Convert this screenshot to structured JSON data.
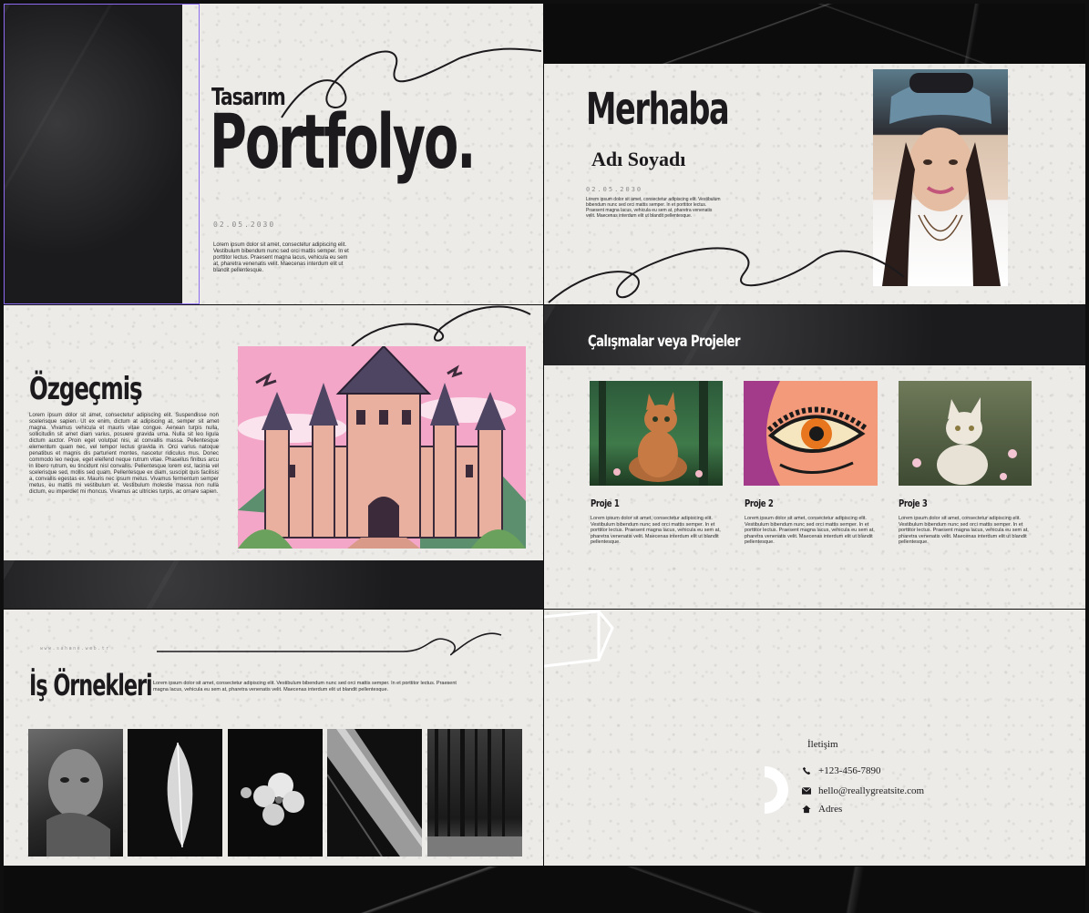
{
  "slide1": {
    "small_title": "Tasarım",
    "big_title": "Portfolyo.",
    "date": "02.05.2030",
    "body": "Lorem ipsum dolor sit amet, consectetur adipiscing elit. Vestibulum bibendum nunc sed orci mattis semper. In et porttitor lectus. Praesent magna lacus, vehicula eu sem at, pharetra venenatis velit. Maecenas interdum elit ut blandit pellentesque."
  },
  "slide2": {
    "greeting": "Merhaba",
    "name": "Adı Soyadı",
    "date": "02.05.2030",
    "body": "Lorem ipsum dolor sit amet, consectetur adipiscing elit. Vestibulum bibendum nunc sed orci mattis semper. In et porttitor lectus. Praesent magna lacus, vehicula eu sem at, pharetra venenatis velit. Maecenas interdum elit ut blandit pellentesque."
  },
  "slide3": {
    "title": "Özgeçmiş",
    "body": "Lorem ipsum dolor sit amet, consectetur adipiscing elit. Suspendisse non scelerisque sapien. Ut ex enim, dictum at adipiscing at, semper sit amet magna. Vivamus vehicula et mauris vitae congue. Aenean turpis nulla, sollicitudin sit amet diam varius, posuere gravida urna. Nulla sit leo ligula dictum auctor. Proin eget volutpat nisi, at convallis massa. Pellentesque elementum quam nec, vel tempor lectus gravida in. Orci varius natoque penatibus et magnis dis parturient montes, nascetur ridiculus mus. Donec commodo leo neque, eget eleifend neque rutrum vitae. Phasellus finibus arcu in libero rutrum, eu tincidunt nisl convallis. Pellentesque lorem est, lacinia vel scelerisque sed, mollis sed quam. Pellentesque ex diam, suscipit quis facilisis a, convallis egestas ex. Mauris nec ipsum metus. Vivamus fermentum semper metus, eu mattis mi vestibulum et. Vestibulum molestie massa non nulla dictum, eu imperdiet mi rhoncus. Vivamus ac ultricies turpis, ac ornare sapien."
  },
  "slide4": {
    "title": "Çalışmalar veya Projeler",
    "projects": [
      {
        "title": "Proje 1",
        "body": "Lorem ipsum dolor sit amet, consectetur adipiscing elit. Vestibulum bibendum nunc sed orci mattis semper. In et porttitor lectus. Praesent magna lacus, vehicula eu sem at, pharetra venenatis velit. Maecenas interdum elit ut blandit pellentesque."
      },
      {
        "title": "Proje 2",
        "body": "Lorem ipsum dolor sit amet, consectetur adipiscing elit. Vestibulum bibendum nunc sed orci mattis semper. In et porttitor lectus. Praesent magna lacus, vehicula eu sem at, pharetra venenatis velit. Maecenas interdum elit ut blandit pellentesque."
      },
      {
        "title": "Proje 3",
        "body": "Lorem ipsum dolor sit amet, consectetur adipiscing elit. Vestibulum bibendum nunc sed orci mattis semper. In et porttitor lectus. Praesent magna lacus, vehicula eu sem at, pharetra venenatis velit. Maecenas interdum elit ut blandit pellentesque."
      }
    ]
  },
  "slide5": {
    "website": "www.sahane.web.tr",
    "title": "İş Örnekleri",
    "body": "Lorem ipsum dolor sit amet, consectetur adipiscing elit. Vestibulum bibendum nunc sed orci mattis semper. In et porttitor lectus. Praesent magna lacus, vehicula eu sem at, pharetra venenatis velit. Maecenas interdum elit ut blandit pellentesque."
  },
  "slide6": {
    "heading": "İletişim",
    "phone": "+123-456-7890",
    "email": "hello@reallygreatsite.com",
    "address": "Adres"
  },
  "colors": {
    "ink": "#1c1a1c",
    "paper": "#ecebe8",
    "selection": "#8b6cf0",
    "castle_sky": "#f3a6c8",
    "castle_wall": "#e9b0a0"
  }
}
